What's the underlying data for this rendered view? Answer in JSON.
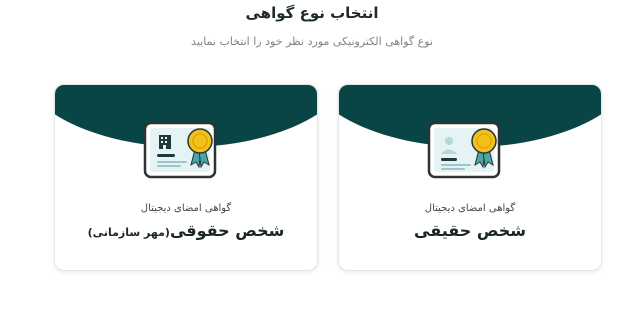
{
  "header": {
    "title": "انتخاب نوع گواهی",
    "subtitle": "نوع گواهی الکترونیکی مورد نظر خود را انتخاب نمایید"
  },
  "cards": [
    {
      "small_label": "گواهی امضای دیجیتال",
      "big_label": "شخص حقیقی",
      "icon": "person-certificate-icon"
    },
    {
      "small_label": "گواهی امضای دیجیتال",
      "big_label": "شخص حقوقی",
      "big_label_suffix": "(مهر سازمانی)",
      "icon": "organization-certificate-icon"
    }
  ],
  "colors": {
    "band": "#0a4546",
    "badge": "#f2c21b",
    "ribbon": "#4aa6a6",
    "cert_bg": "#e6f3f4"
  }
}
